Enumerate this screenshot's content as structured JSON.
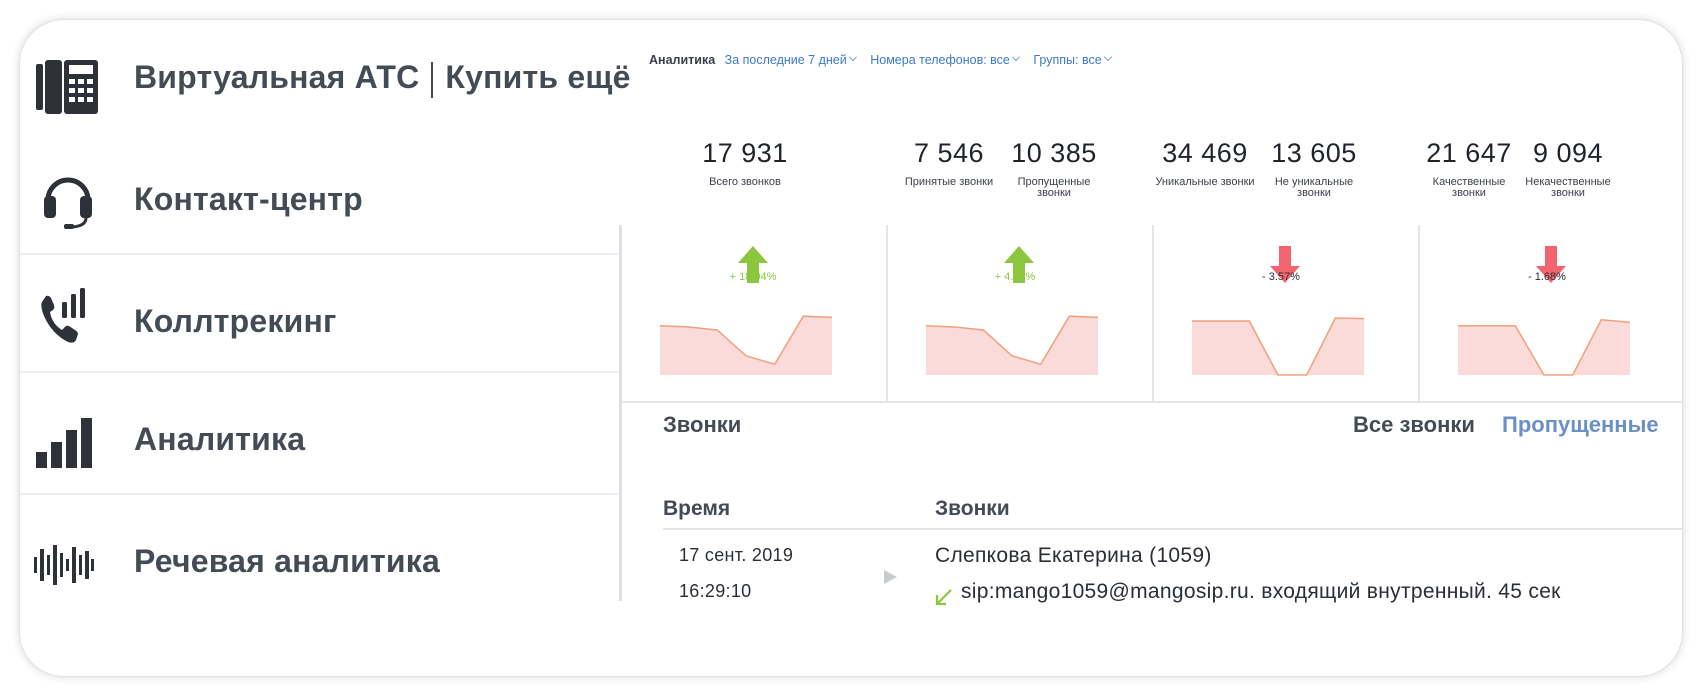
{
  "sidebar": {
    "header": {
      "title": "Виртуальная АТС",
      "buy": "Купить ещё",
      "icon": "office-phone-icon"
    },
    "items": [
      {
        "label": "Контакт-центр",
        "icon": "headset-icon"
      },
      {
        "label": "Коллтрекинг",
        "icon": "phone-signal-icon"
      },
      {
        "label": "Аналитика",
        "icon": "bar-chart-icon"
      },
      {
        "label": "Речевая аналитика",
        "icon": "waveform-icon"
      }
    ]
  },
  "filters": {
    "label": "Аналитика",
    "period": "За последние 7 дней",
    "phones": "Номера телефонов: все",
    "groups": "Группы: все"
  },
  "stats": [
    {
      "value": "17 931",
      "caption": "Всего звонков"
    },
    {
      "value": "7 546",
      "caption": "Принятые звонки"
    },
    {
      "value": "10 385",
      "caption": "Пропущенные звонки"
    },
    {
      "value": "34 469",
      "caption": "Уникальные звонки"
    },
    {
      "value": "13 605",
      "caption": "Не уникальные звонки"
    },
    {
      "value": "21 647",
      "caption": "Качественные звонки"
    },
    {
      "value": "9 094",
      "caption": "Некачественные звонки"
    }
  ],
  "trends": [
    {
      "direction": "up",
      "delta": "+ 18.04%",
      "color": "#8cc63f",
      "spark": [
        0.82,
        0.8,
        0.75,
        0.32,
        0.18,
        0.98,
        0.96
      ]
    },
    {
      "direction": "up",
      "delta": "+ 4.83%",
      "color": "#8cc63f",
      "spark": [
        0.82,
        0.8,
        0.75,
        0.32,
        0.18,
        0.98,
        0.96
      ]
    },
    {
      "direction": "down",
      "delta": "- 3.57%",
      "color": "#f2656f",
      "spark": [
        0.9,
        0.9,
        0.9,
        0.0,
        0.0,
        0.95,
        0.94
      ]
    },
    {
      "direction": "down",
      "delta": "- 1.68%",
      "color": "#f2656f",
      "spark": [
        0.82,
        0.82,
        0.82,
        0.0,
        0.0,
        0.92,
        0.88
      ]
    }
  ],
  "calls": {
    "title": "Звонки",
    "tabs": {
      "all": "Все звонки",
      "missed": "Пропущенные"
    },
    "columns": {
      "time": "Время",
      "calls": "Звонки"
    },
    "rows": [
      {
        "date": "17 сент. 2019",
        "time": "16:29:10",
        "name": "Слепкова Екатерина (1059)",
        "detail": "sip:mango1059@mangosip.ru. входящий внутренный. 45 сек"
      }
    ]
  },
  "colors": {
    "accent": "#6b8fc7",
    "filter_link": "#3d79c9",
    "up": "#8cc63f",
    "down": "#f2656f",
    "spark_fill": "#fbdada",
    "spark_line": "#f0a07c"
  }
}
